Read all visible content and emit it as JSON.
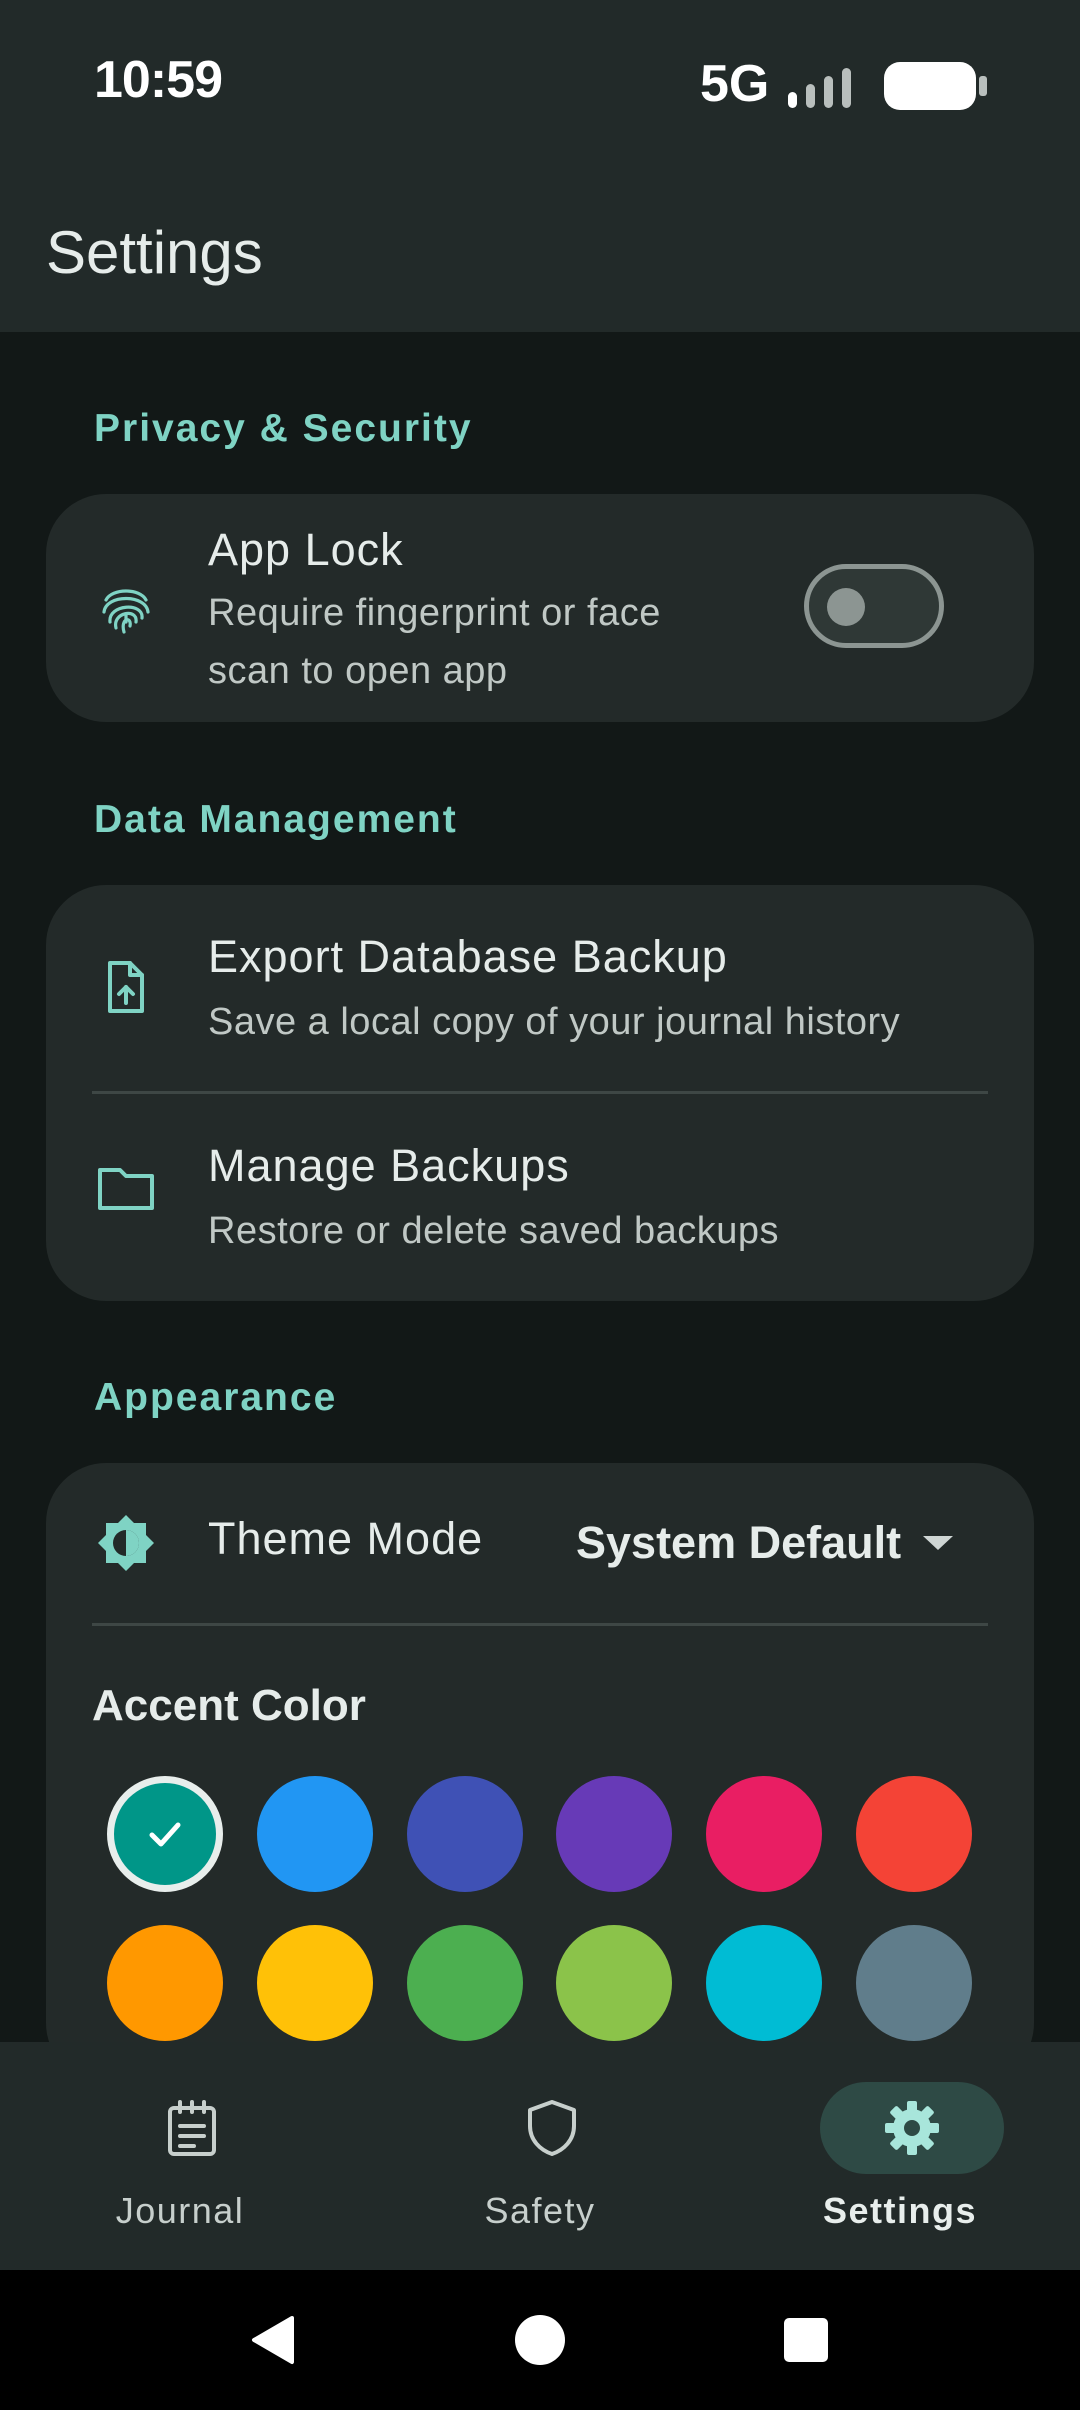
{
  "status_bar": {
    "time": "10:59",
    "network": "5G"
  },
  "app_bar": {
    "title": "Settings"
  },
  "sections": {
    "privacy": {
      "title": "Privacy & Security",
      "app_lock": {
        "title": "App Lock",
        "subtitle_line1": "Require fingerprint or face",
        "subtitle_line2": "scan to open app",
        "enabled": false,
        "icon": "fingerprint-icon"
      }
    },
    "data": {
      "title": "Data Management",
      "export": {
        "title": "Export Database Backup",
        "subtitle": "Save a local copy of your journal history",
        "icon": "file-upload-icon"
      },
      "manage": {
        "title": "Manage Backups",
        "subtitle": "Restore or delete saved backups",
        "icon": "folder-icon"
      }
    },
    "appearance": {
      "title": "Appearance",
      "theme_mode": {
        "label": "Theme Mode",
        "value": "System Default",
        "icon": "contrast-icon"
      },
      "accent_color": {
        "label": "Accent Color",
        "selected": "#009688",
        "colors": [
          "#009688",
          "#2196F3",
          "#3F51B5",
          "#673AB7",
          "#E91E63",
          "#F44336",
          "#FF9800",
          "#FFC107",
          "#4CAF50",
          "#8BC34A",
          "#00BCD4",
          "#607D8B"
        ]
      }
    }
  },
  "bottom_nav": {
    "items": [
      {
        "label": "Journal",
        "icon": "journal-icon",
        "active": false
      },
      {
        "label": "Safety",
        "icon": "shield-icon",
        "active": false
      },
      {
        "label": "Settings",
        "icon": "gear-icon",
        "active": true
      }
    ]
  },
  "theme": {
    "accent": "#7fd3c4",
    "background": "#121817",
    "surface": "#232a29"
  }
}
